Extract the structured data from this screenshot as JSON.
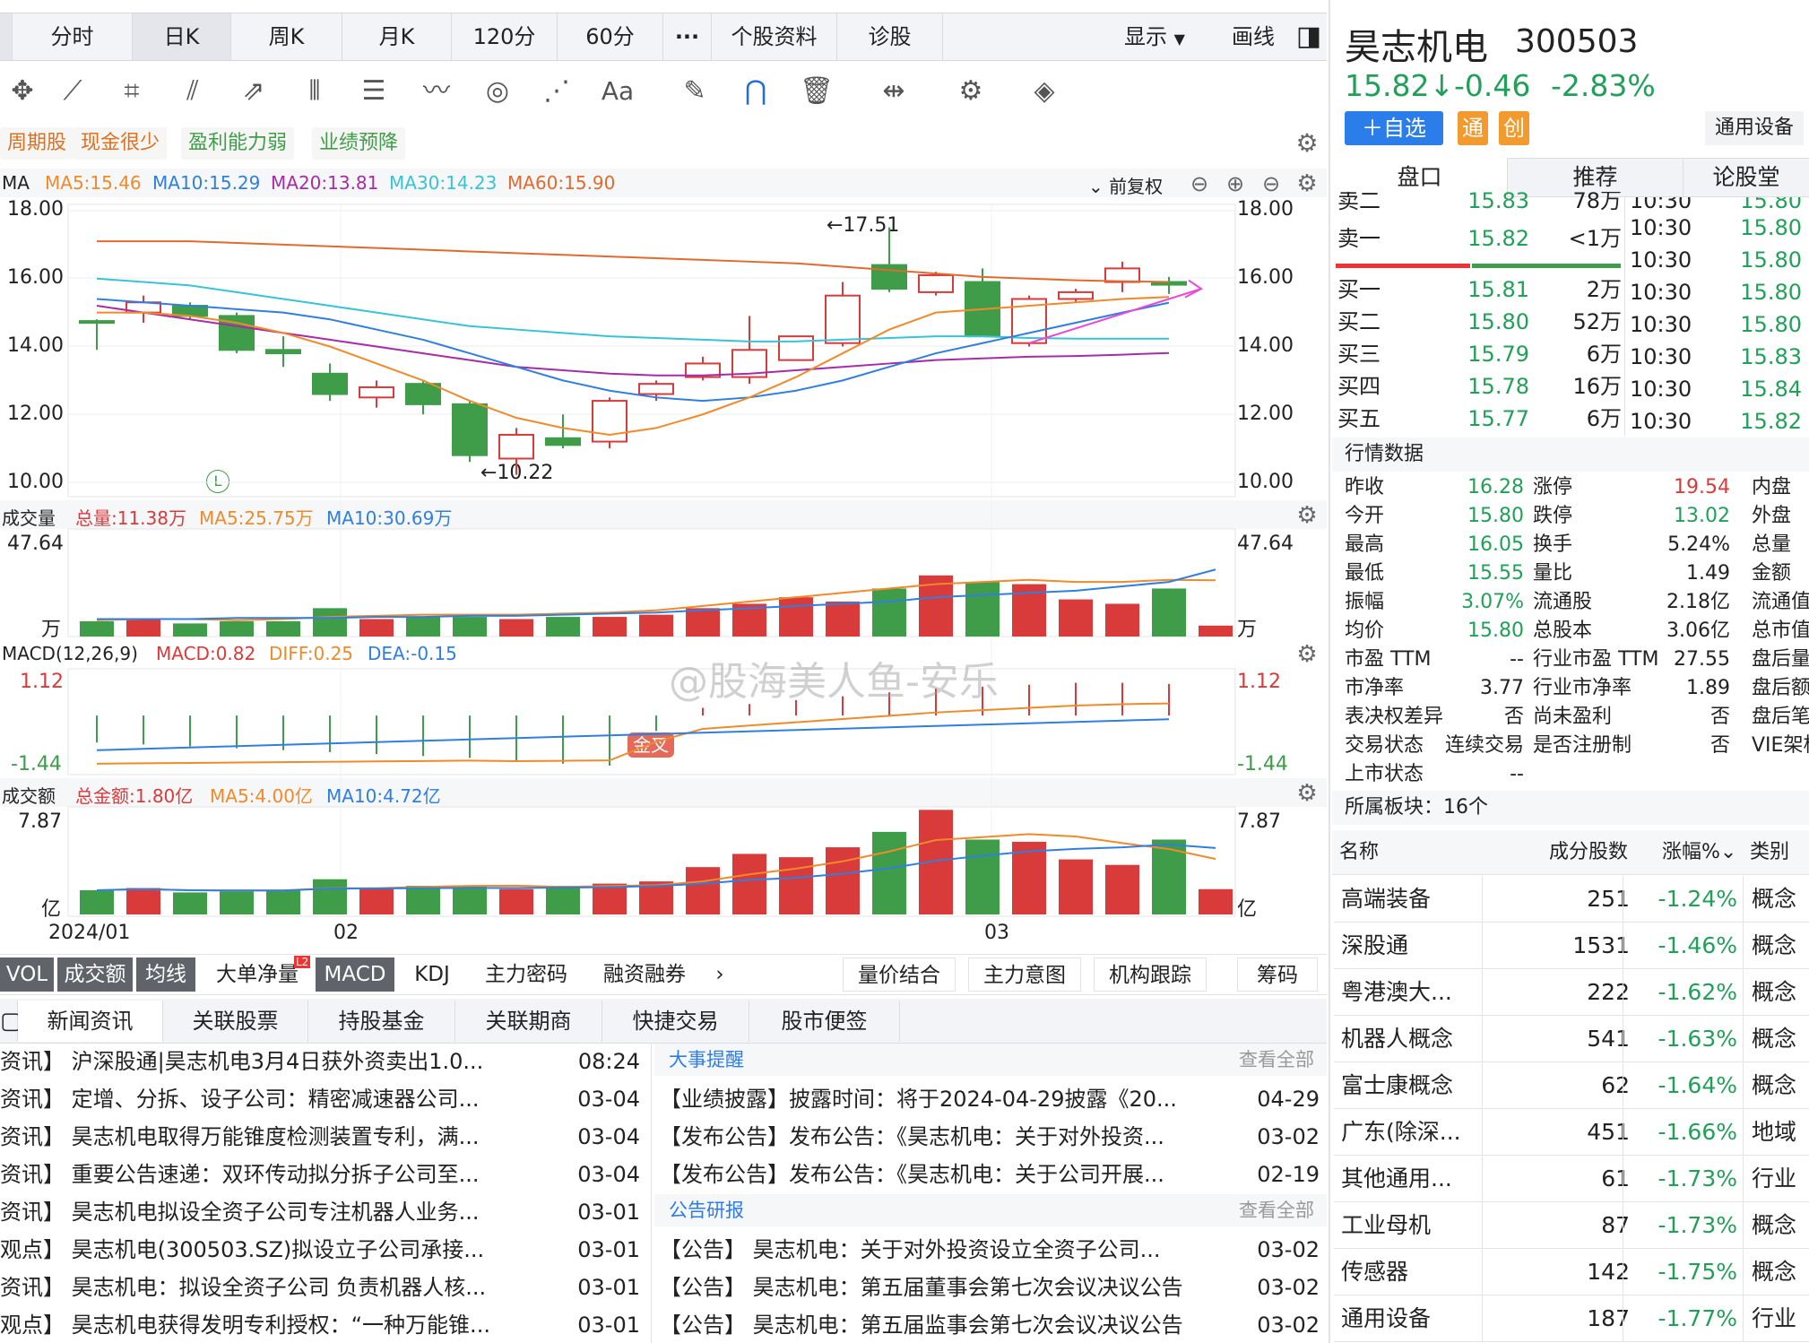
{
  "toolbar": {
    "tabs": [
      "分时",
      "日K",
      "周K",
      "月K",
      "120分",
      "60分",
      "···",
      "个股资料",
      "诊股"
    ],
    "display_label": "显示",
    "draw_label": "画线"
  },
  "tags": [
    "周期股",
    "现金很少",
    "盈利能力弱",
    "业绩预降"
  ],
  "ma_legend": {
    "label": "MA",
    "ma5": "MA5:15.46",
    "ma10": "MA10:15.29",
    "ma20": "MA20:13.81",
    "ma30": "MA30:14.23",
    "ma60": "MA60:15.90",
    "adjust": "前复权"
  },
  "price_axis": [
    "18.00",
    "16.00",
    "14.00",
    "12.00",
    "10.00"
  ],
  "price_annotations": {
    "high": "←17.51",
    "low": "←10.22",
    "marker": "L"
  },
  "vol_legend": {
    "label": "成交量",
    "total": "总量:11.38万",
    "ma5": "MA5:25.75万",
    "ma10": "MA10:30.69万",
    "max": "47.64",
    "unit": "万"
  },
  "macd_legend": {
    "label": "MACD(12,26,9)",
    "macd": "MACD:0.82",
    "diff": "DIFF:0.25",
    "dea": "DEA:-0.15",
    "max": "1.12",
    "min": "-1.44",
    "cross": "金叉"
  },
  "amt_legend": {
    "label": "成交额",
    "total": "总金额:1.80亿",
    "ma5": "MA5:4.00亿",
    "ma10": "MA10:4.72亿",
    "max": "7.87",
    "unit": "亿"
  },
  "date_axis": [
    "2024/01",
    "02",
    "03"
  ],
  "watermark": "@股海美人鱼-安乐",
  "indicator_tabs": [
    "VOL",
    "成交额",
    "均线",
    "大单净量",
    "MACD",
    "KDJ",
    "主力密码",
    "融资融券",
    "›"
  ],
  "indicator_badge": "L2",
  "right_tabs": [
    "量价结合",
    "主力意图",
    "机构跟踪",
    "筹码"
  ],
  "news_tabs": [
    "新闻资讯",
    "关联股票",
    "持股基金",
    "关联期商",
    "快捷交易",
    "股市便签"
  ],
  "news": [
    {
      "t": "资讯】 沪深股通|昊志机电3月4日获外资卖出1.0...",
      "d": "08:24"
    },
    {
      "t": "资讯】 定增、分拆、设子公司：精密减速器公司...",
      "d": "03-04"
    },
    {
      "t": "资讯】 昊志机电取得万能锥度检测装置专利，满...",
      "d": "03-04"
    },
    {
      "t": "资讯】 重要公告速递：双环传动拟分拆子公司至...",
      "d": "03-04"
    },
    {
      "t": "资讯】 昊志机电拟设全资子公司专注机器人业务...",
      "d": "03-01"
    },
    {
      "t": "观点】 昊志机电(300503.SZ)拟设立子公司承接...",
      "d": "03-01"
    },
    {
      "t": "资讯】 昊志机电：拟设全资子公司 负责机器人核...",
      "d": "03-01"
    },
    {
      "t": "观点】 昊志机电获得发明专利授权：“一种万能锥...",
      "d": "03-01"
    }
  ],
  "events_header": {
    "title": "大事提醒",
    "more": "查看全部"
  },
  "events": [
    {
      "t": "【业绩披露】披露时间：将于2024-04-29披露《20...",
      "d": "04-29"
    },
    {
      "t": "【发布公告】发布公告：《昊志机电：关于对外投资...",
      "d": "03-02"
    },
    {
      "t": "【发布公告】发布公告：《昊志机电：关于公司开展...",
      "d": "02-19"
    }
  ],
  "notices_header": {
    "title": "公告研报",
    "more": "查看全部"
  },
  "notices": [
    {
      "t": "【公告】 昊志机电：关于对外投资设立全资子公司...",
      "d": "03-02"
    },
    {
      "t": "【公告】 昊志机电：第五届董事会第七次会议决议公告",
      "d": "03-02"
    },
    {
      "t": "【公告】 昊志机电：第五届监事会第七次会议决议公告",
      "d": "03-02"
    }
  ],
  "stock": {
    "name": "昊志机电",
    "code": "300503",
    "price": "15.82↓",
    "change": "-0.46",
    "pct": "-2.83%",
    "add_btn": "＋自选",
    "badge1": "通",
    "badge2": "创",
    "industry": "通用设备"
  },
  "panel_tabs": [
    "盘口",
    "推荐",
    "论股堂"
  ],
  "orderbook": [
    {
      "n": "卖二",
      "p": "15.83",
      "v": "78万"
    },
    {
      "n": "卖一",
      "p": "15.82",
      "v": "<1万"
    },
    {
      "n": "买一",
      "p": "15.81",
      "v": "2万"
    },
    {
      "n": "买二",
      "p": "15.80",
      "v": "52万"
    },
    {
      "n": "买三",
      "p": "15.79",
      "v": "6万"
    },
    {
      "n": "买四",
      "p": "15.78",
      "v": "16万"
    },
    {
      "n": "买五",
      "p": "15.77",
      "v": "6万"
    }
  ],
  "ticks": [
    {
      "t": "10:30",
      "p": "15.80"
    },
    {
      "t": "10:30",
      "p": "15.80"
    },
    {
      "t": "10:30",
      "p": "15.80"
    },
    {
      "t": "10:30",
      "p": "15.80"
    },
    {
      "t": "10:30",
      "p": "15.83"
    },
    {
      "t": "10:30",
      "p": "15.84"
    },
    {
      "t": "10:30",
      "p": "15.82"
    }
  ],
  "quote_title": "行情数据",
  "quotes": [
    {
      "a": "昨收",
      "b": "16.28",
      "c": "涨停",
      "d": "19.54",
      "e": "内盘"
    },
    {
      "a": "今开",
      "b": "15.80",
      "c": "跌停",
      "d": "13.02",
      "e": "外盘"
    },
    {
      "a": "最高",
      "b": "16.05",
      "c": "换手",
      "d": "5.24%",
      "e": "总量"
    },
    {
      "a": "最低",
      "b": "15.55",
      "c": "量比",
      "d": "1.49",
      "e": "金额"
    },
    {
      "a": "振幅",
      "b": "3.07%",
      "c": "流通股",
      "d": "2.18亿",
      "e": "流通值"
    },
    {
      "a": "均价",
      "b": "15.80",
      "c": "总股本",
      "d": "3.06亿",
      "e": "总市值"
    },
    {
      "a": "市盈 TTM",
      "b": "--",
      "c": "行业市盈 TTM",
      "d": "27.55",
      "e": "盘后量"
    },
    {
      "a": "市净率",
      "b": "3.77",
      "c": "行业市净率",
      "d": "1.89",
      "e": "盘后额"
    },
    {
      "a": "表决权差异",
      "b": "否",
      "c": "尚未盈利",
      "d": "否",
      "e": "盘后笔数"
    },
    {
      "a": "交易状态",
      "b": "连续交易",
      "c": "是否注册制",
      "d": "否",
      "e": "VIE架构"
    },
    {
      "a": "上市状态",
      "b": "--",
      "c": "",
      "d": "",
      "e": ""
    }
  ],
  "sector_title": "所属板块：16个",
  "sector_headers": [
    "名称",
    "成分股数",
    "涨幅%",
    "类别"
  ],
  "sectors": [
    {
      "n": "高端装备",
      "c": "251",
      "p": "-1.24%",
      "k": "概念"
    },
    {
      "n": "深股通",
      "c": "1531",
      "p": "-1.46%",
      "k": "概念"
    },
    {
      "n": "粤港澳大...",
      "c": "222",
      "p": "-1.62%",
      "k": "概念"
    },
    {
      "n": "机器人概念",
      "c": "541",
      "p": "-1.63%",
      "k": "概念"
    },
    {
      "n": "富士康概念",
      "c": "62",
      "p": "-1.64%",
      "k": "概念"
    },
    {
      "n": "广东(除深...",
      "c": "451",
      "p": "-1.66%",
      "k": "地域"
    },
    {
      "n": "其他通用...",
      "c": "61",
      "p": "-1.73%",
      "k": "行业"
    },
    {
      "n": "工业母机",
      "c": "87",
      "p": "-1.73%",
      "k": "概念"
    },
    {
      "n": "传感器",
      "c": "142",
      "p": "-1.75%",
      "k": "概念"
    },
    {
      "n": "通用设备",
      "c": "187",
      "p": "-1.77%",
      "k": "行业"
    }
  ],
  "colors": {
    "up": "#d93a3a",
    "down": "#3f9d4a",
    "ma5": "#f08a2a",
    "ma10": "#2f7fe0",
    "ma20": "#a62ca8",
    "ma30": "#36c4d6",
    "ma60": "#e26a2c",
    "accent": "#2b7de9"
  },
  "chart_data": {
    "type": "candlestick",
    "price_range": [
      10,
      18
    ],
    "candles": [
      {
        "o": 14.75,
        "c": 14.7,
        "h": 14.8,
        "l": 13.9
      },
      {
        "o": 15.0,
        "c": 15.3,
        "h": 15.5,
        "l": 14.7
      },
      {
        "o": 15.2,
        "c": 14.9,
        "h": 15.3,
        "l": 14.8
      },
      {
        "o": 14.9,
        "c": 13.9,
        "h": 15.0,
        "l": 13.8
      },
      {
        "o": 13.9,
        "c": 13.8,
        "h": 14.3,
        "l": 13.4
      },
      {
        "o": 13.2,
        "c": 12.6,
        "h": 13.5,
        "l": 12.4
      },
      {
        "o": 12.5,
        "c": 12.8,
        "h": 13.0,
        "l": 12.2
      },
      {
        "o": 12.9,
        "c": 12.3,
        "h": 13.0,
        "l": 12.0
      },
      {
        "o": 12.3,
        "c": 10.8,
        "h": 12.4,
        "l": 10.6
      },
      {
        "o": 10.7,
        "c": 11.4,
        "h": 11.6,
        "l": 10.22
      },
      {
        "o": 11.3,
        "c": 11.1,
        "h": 12.0,
        "l": 11.0
      },
      {
        "o": 11.2,
        "c": 12.4,
        "h": 12.5,
        "l": 11.0
      },
      {
        "o": 12.6,
        "c": 12.9,
        "h": 13.0,
        "l": 12.4
      },
      {
        "o": 13.1,
        "c": 13.5,
        "h": 13.7,
        "l": 13.0
      },
      {
        "o": 13.1,
        "c": 13.9,
        "h": 14.9,
        "l": 12.9
      },
      {
        "o": 13.6,
        "c": 14.3,
        "h": 14.3,
        "l": 13.6
      },
      {
        "o": 14.1,
        "c": 15.5,
        "h": 15.9,
        "l": 14.0
      },
      {
        "o": 16.4,
        "c": 15.7,
        "h": 17.51,
        "l": 15.6
      },
      {
        "o": 15.6,
        "c": 16.1,
        "h": 16.2,
        "l": 15.5
      },
      {
        "o": 15.9,
        "c": 14.3,
        "h": 16.3,
        "l": 14.3
      },
      {
        "o": 14.1,
        "c": 15.4,
        "h": 15.5,
        "l": 14.0
      },
      {
        "o": 15.4,
        "c": 15.6,
        "h": 15.7,
        "l": 15.3
      },
      {
        "o": 15.9,
        "c": 16.3,
        "h": 16.5,
        "l": 15.6
      },
      {
        "o": 15.9,
        "c": 15.82,
        "h": 16.05,
        "l": 15.55
      }
    ],
    "ma5": [
      15.0,
      15.0,
      14.9,
      14.7,
      14.4,
      14.0,
      13.5,
      13.0,
      12.4,
      11.9,
      11.6,
      11.4,
      11.6,
      12.0,
      12.5,
      13.1,
      13.8,
      14.5,
      15.0,
      15.1,
      15.2,
      15.3,
      15.4,
      15.46
    ],
    "ma10": [
      15.4,
      15.3,
      15.2,
      15.1,
      15.0,
      14.8,
      14.5,
      14.2,
      13.8,
      13.4,
      13.0,
      12.7,
      12.5,
      12.4,
      12.5,
      12.7,
      13.0,
      13.4,
      13.8,
      14.1,
      14.4,
      14.7,
      15.0,
      15.29
    ],
    "ma20": [
      15.2,
      15.0,
      14.8,
      14.6,
      14.4,
      14.2,
      14.0,
      13.8,
      13.6,
      13.4,
      13.3,
      13.2,
      13.15,
      13.15,
      13.2,
      13.3,
      13.4,
      13.5,
      13.6,
      13.65,
      13.7,
      13.72,
      13.76,
      13.81
    ],
    "ma30": [
      16.0,
      15.9,
      15.8,
      15.6,
      15.4,
      15.2,
      15.0,
      14.8,
      14.6,
      14.5,
      14.4,
      14.3,
      14.25,
      14.2,
      14.15,
      14.15,
      14.2,
      14.25,
      14.3,
      14.3,
      14.25,
      14.23,
      14.23,
      14.23
    ],
    "ma60": [
      17.1,
      17.1,
      17.1,
      17.05,
      17.0,
      16.95,
      16.9,
      16.85,
      16.8,
      16.75,
      16.7,
      16.65,
      16.6,
      16.55,
      16.5,
      16.45,
      16.35,
      16.25,
      16.15,
      16.05,
      16.0,
      15.95,
      15.92,
      15.9
    ],
    "volume": [
      7,
      8,
      6,
      7,
      7,
      13,
      8,
      9,
      9,
      8,
      9,
      9,
      10,
      13,
      15,
      18,
      16,
      22,
      28,
      25,
      24,
      17,
      15,
      22,
      5
    ],
    "volume_max": 47.64,
    "volume_ma5": [
      7.5,
      8,
      8,
      7.5,
      8,
      9,
      9.5,
      10,
      10,
      10,
      10.5,
      11,
      12,
      14,
      16,
      18,
      20,
      22,
      24,
      25,
      26,
      25,
      25,
      26,
      25.75
    ],
    "volume_ma10": [
      8,
      8,
      8,
      8.5,
      8.5,
      8.5,
      9,
      9,
      9.5,
      9.5,
      10,
      10.5,
      11,
      12,
      13,
      14,
      15,
      16,
      18,
      19,
      20,
      21,
      23,
      25,
      30.69
    ],
    "macd_hist": [
      -0.7,
      -0.75,
      -0.8,
      -0.85,
      -0.9,
      -0.95,
      -1.0,
      -1.05,
      -1.1,
      -1.2,
      -1.25,
      -1.3,
      -0.4,
      0.2,
      0.3,
      0.4,
      0.5,
      0.6,
      0.7,
      0.75,
      0.8,
      0.85,
      0.85,
      0.82
    ],
    "macd_range": [
      -1.44,
      1.12
    ],
    "amount": [
      2.2,
      2.4,
      2.0,
      2.1,
      2.2,
      3.2,
      2.4,
      2.6,
      2.6,
      2.3,
      2.6,
      2.8,
      3.0,
      4.3,
      5.5,
      5.2,
      6.1,
      7.5,
      9.5,
      6.8,
      6.6,
      5.0,
      4.5,
      6.8,
      2.3
    ],
    "amount_max": 7.87,
    "dates": [
      "2024/01",
      "02",
      "03"
    ],
    "ylabel": ""
  }
}
